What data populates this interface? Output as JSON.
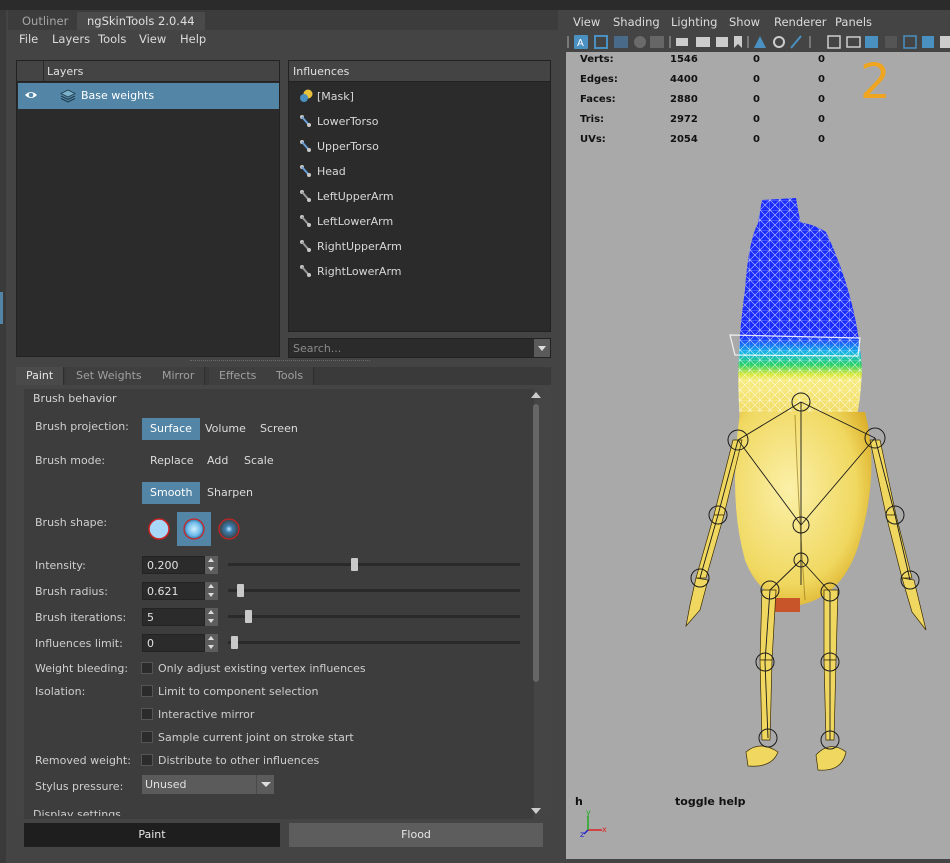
{
  "tabs": [
    {
      "label": "Outliner"
    },
    {
      "label": "ngSkinTools 2.0.44",
      "active": true
    }
  ],
  "menu": [
    "File",
    "Layers",
    "Tools",
    "View",
    "Help"
  ],
  "layers_panel": {
    "header": "Layers",
    "rows": [
      {
        "label": "Base weights",
        "selected": true
      }
    ]
  },
  "influences_panel": {
    "header": "Influences",
    "items": [
      {
        "label": "[Mask]",
        "icon": "mask-icon"
      },
      {
        "label": "LowerTorso",
        "icon": "joint-icon"
      },
      {
        "label": "UpperTorso",
        "icon": "joint-icon"
      },
      {
        "label": "Head",
        "icon": "joint-icon"
      },
      {
        "label": "LeftUpperArm",
        "icon": "joint-icon"
      },
      {
        "label": "LeftLowerArm",
        "icon": "joint-icon"
      },
      {
        "label": "RightUpperArm",
        "icon": "joint-icon"
      },
      {
        "label": "RightLowerArm",
        "icon": "joint-icon"
      }
    ],
    "search_placeholder": "Search..."
  },
  "bottom_tabs": [
    "Paint",
    "Set Weights",
    "Mirror",
    "Effects",
    "Tools"
  ],
  "brush": {
    "section_title": "Brush behavior",
    "projection_label": "Brush projection:",
    "projection_options": [
      "Surface",
      "Volume",
      "Screen"
    ],
    "projection_selected": "Surface",
    "mode_label": "Brush mode:",
    "mode_options": [
      "Replace",
      "Add",
      "Scale"
    ],
    "mode_options2": [
      "Smooth",
      "Sharpen"
    ],
    "mode_selected": "Smooth",
    "shape_label": "Brush shape:",
    "shape_selected_index": 1,
    "intensity_label": "Intensity:",
    "intensity": "0.200",
    "intensity_slider": 0.42,
    "radius_label": "Brush radius:",
    "radius": "0.621",
    "radius_slider": 0.02,
    "iterations_label": "Brush iterations:",
    "iterations": "5",
    "iterations_slider": 0.05,
    "influences_limit_label": "Influences limit:",
    "influences_limit": "0",
    "influences_limit_slider": 0.0,
    "weight_bleeding_label": "Weight bleeding:",
    "weight_bleeding_option": "Only adjust existing vertex influences",
    "isolation_label": "Isolation:",
    "isolation_options": [
      "Limit to component selection",
      "Interactive mirror",
      "Sample current joint on stroke start"
    ],
    "removed_weight_label": "Removed weight:",
    "removed_weight_option": "Distribute to other influences",
    "stylus_label": "Stylus pressure:",
    "stylus_value": "Unused",
    "next_section": "Display settings"
  },
  "buttons": {
    "paint": "Paint",
    "flood": "Flood"
  },
  "viewport": {
    "menu": [
      "View",
      "Shading",
      "Lighting",
      "Show",
      "Renderer",
      "Panels"
    ],
    "hud": [
      {
        "label": "Verts:",
        "values": [
          "1546",
          "0",
          "0"
        ]
      },
      {
        "label": "Edges:",
        "values": [
          "4400",
          "0",
          "0"
        ]
      },
      {
        "label": "Faces:",
        "values": [
          "2880",
          "0",
          "0"
        ]
      },
      {
        "label": "Tris:",
        "values": [
          "2972",
          "0",
          "0"
        ]
      },
      {
        "label": "UVs:",
        "values": [
          "2054",
          "0",
          "0"
        ]
      }
    ],
    "overlay_number": "2",
    "h_label": "h",
    "toggle_help": "toggle help",
    "axis_labels": {
      "x": "x",
      "y": "y",
      "z": "z"
    },
    "accent_color": "#5285a6",
    "annotation_color": "#f0a520"
  }
}
